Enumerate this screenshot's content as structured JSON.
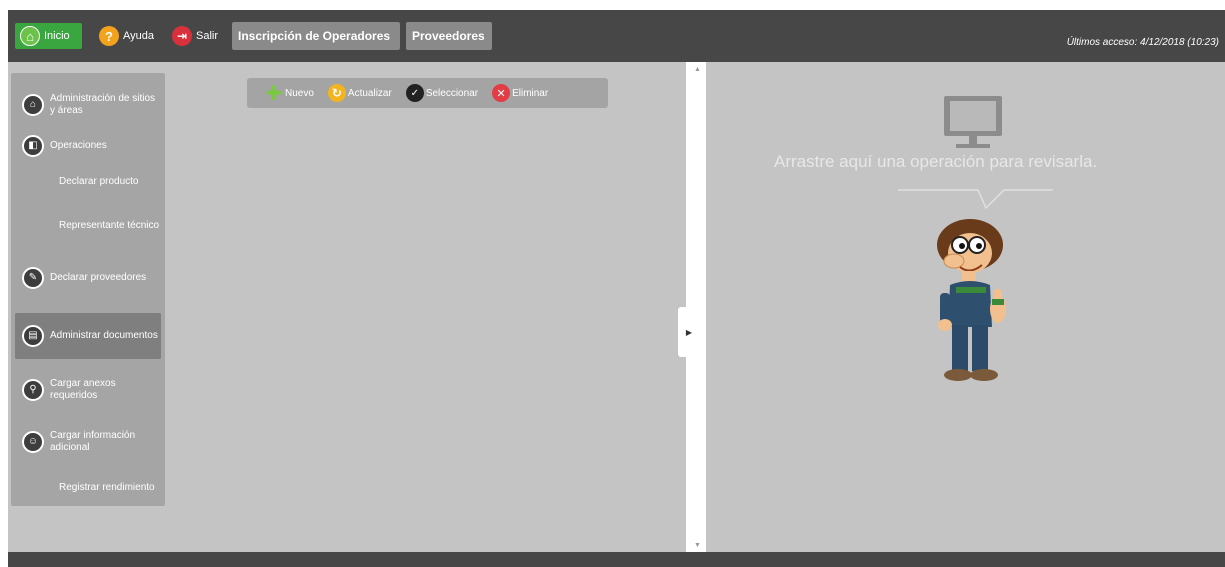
{
  "topbar": {
    "home_label": "Inicio",
    "help_label": "Ayuda",
    "exit_label": "Salir",
    "tabs": [
      {
        "label": "Inscripción de Operadores"
      },
      {
        "label": "Proveedores"
      }
    ],
    "last_access": "Últimos acceso: 4/12/2018 (10:23)"
  },
  "sidebar": {
    "items": [
      {
        "label": "Administración de sitios y áreas",
        "icon": "sites-icon"
      },
      {
        "label": "Operaciones",
        "icon": "operations-icon"
      },
      {
        "label": "Declarar producto",
        "icon": ""
      },
      {
        "label": "Representante técnico",
        "icon": ""
      },
      {
        "label": "Declarar proveedores",
        "icon": "suppliers-icon"
      },
      {
        "label": "Administrar documentos",
        "icon": "documents-icon",
        "active": true
      },
      {
        "label": "Cargar anexos requeridos",
        "icon": "attachment-icon"
      },
      {
        "label": "Cargar información adicional",
        "icon": "info-icon"
      },
      {
        "label": "Registrar rendimiento",
        "icon": ""
      }
    ]
  },
  "toolbar": {
    "new_label": "Nuevo",
    "refresh_label": "Actualizar",
    "select_label": "Seleccionar",
    "delete_label": "Eliminar"
  },
  "drop_panel": {
    "message": "Arrastre aquí una operación para revisarla."
  },
  "colors": {
    "topbar": "#474747",
    "home_button": "#3aa63f",
    "panel_background": "#c4c4c4",
    "sidebar": "#a5a5a5"
  }
}
